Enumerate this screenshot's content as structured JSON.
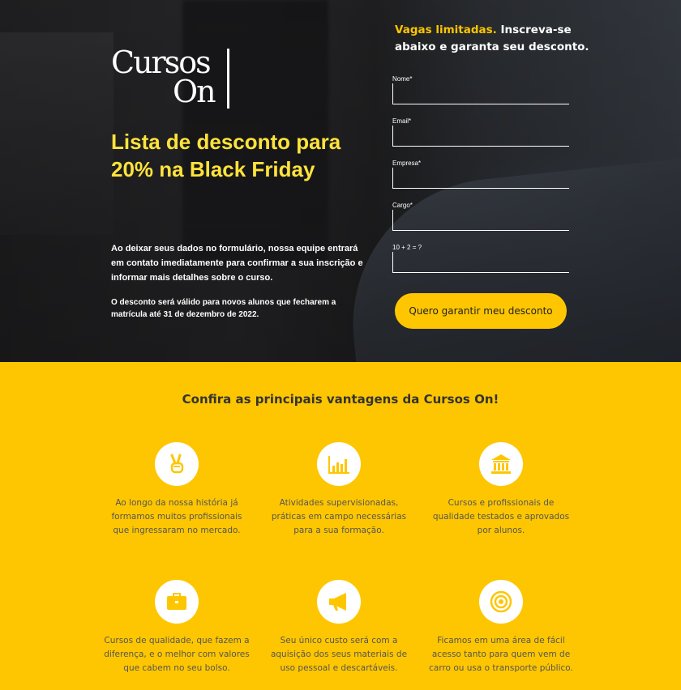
{
  "logo": {
    "line1": "Cursos",
    "line2": "On"
  },
  "hero": {
    "headline": "Lista de desconto para 20% na Black Friday",
    "intro": "Ao deixar seus dados no formulário, nossa equipe entrará em contato imediatamente para confirmar a sua inscrição e informar mais detalhes sobre o curso.",
    "note": "O desconto será válido para novos alunos que fecharem a matrícula até 31 de dezembro de 2022."
  },
  "form": {
    "title_highlight": "Vagas limitadas.",
    "title_rest": " Inscreva-se abaixo e garanta seu desconto.",
    "fields": [
      {
        "label": "Nome*",
        "value": ""
      },
      {
        "label": "Email*",
        "value": ""
      },
      {
        "label": "Empresa*",
        "value": ""
      },
      {
        "label": "Cargo*",
        "value": ""
      },
      {
        "label": "10 + 2 = ?",
        "value": ""
      }
    ],
    "submit_label": "Quero garantir meu desconto"
  },
  "benefits": {
    "title": "Confira as principais vantagens da Cursos On!",
    "items": [
      {
        "icon": "victory-hand-icon",
        "text": "Ao longo da nossa história já formamos muitos profissionais que ingressaram no mercado."
      },
      {
        "icon": "bar-chart-icon",
        "text": "Atividades supervisionadas, práticas em campo necessárias para a sua formação."
      },
      {
        "icon": "institution-icon",
        "text": "Cursos e profissionais de qualidade testados e aprovados por alunos."
      },
      {
        "icon": "briefcase-icon",
        "text": "Cursos de qualidade, que fazem a diferença, e o melhor com valores que cabem no seu bolso."
      },
      {
        "icon": "megaphone-icon",
        "text": "Seu único custo será com a aquisição dos seus materiais de uso pessoal e descartáveis."
      },
      {
        "icon": "target-icon",
        "text": "Ficamos em uma área de fácil acesso tanto para quem vem de carro ou usa o transporte público."
      }
    ]
  },
  "colors": {
    "accent": "#fec600",
    "headline": "#fee33b",
    "text_dark": "#555555"
  }
}
